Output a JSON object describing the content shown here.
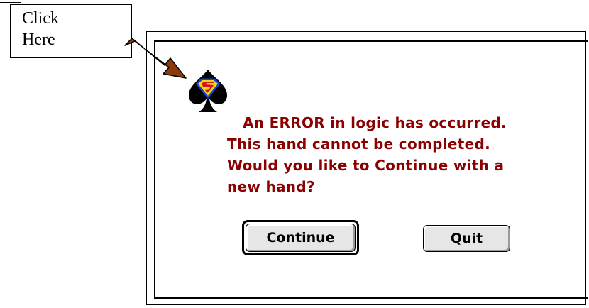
{
  "callout": {
    "line1": "Click",
    "line2": "Here"
  },
  "dialog": {
    "icon": "superman-spade-icon",
    "message_lines": [
      "An ERROR in logic has occurred.",
      "This hand cannot be completed.",
      "Would you like to Continue with a",
      "new hand?"
    ],
    "message_color": "#8b0000",
    "continue_label": "Continue",
    "quit_label": "Quit"
  },
  "arrow_color": "#8b3a0e"
}
